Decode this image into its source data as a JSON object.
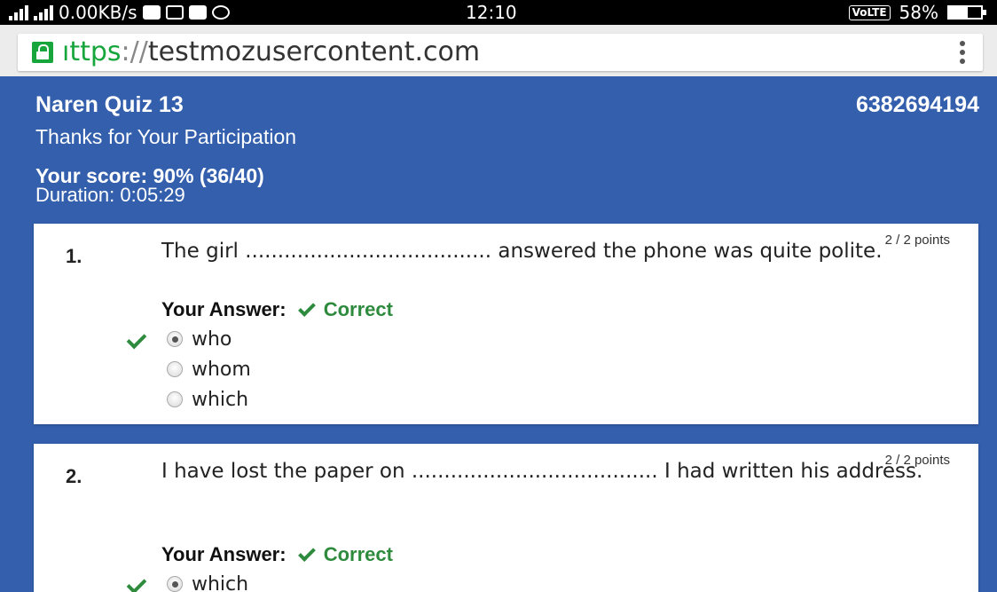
{
  "status_bar": {
    "network_speed": "0.00KB/s",
    "time": "12:10",
    "volte": "VoLTE",
    "battery": "58%",
    "battery_level": 0.58
  },
  "browser": {
    "url_scheme_visible": "ıttps",
    "url_sep": "://",
    "url_host": "testmozusercontent.com"
  },
  "quiz": {
    "title": "Naren Quiz 13",
    "phone": "6382694194",
    "thanks": "Thanks for Your Participation",
    "score": "Your score: 90% (36/40)",
    "duration": "Duration: 0:05:29"
  },
  "questions": [
    {
      "number": "1.",
      "text": "The girl ...................................... answered the phone was quite polite.",
      "points": "2 / 2 points",
      "answer_label": "Your Answer:",
      "result": "Correct",
      "options": [
        "who",
        "whom",
        "which"
      ],
      "selected_index": 0
    },
    {
      "number": "2.",
      "text": "I have lost the paper on ...................................... I had written his address.",
      "points": "2 / 2 points",
      "answer_label": "Your Answer:",
      "result": "Correct",
      "options": [
        "which"
      ],
      "selected_index": 0
    }
  ]
}
